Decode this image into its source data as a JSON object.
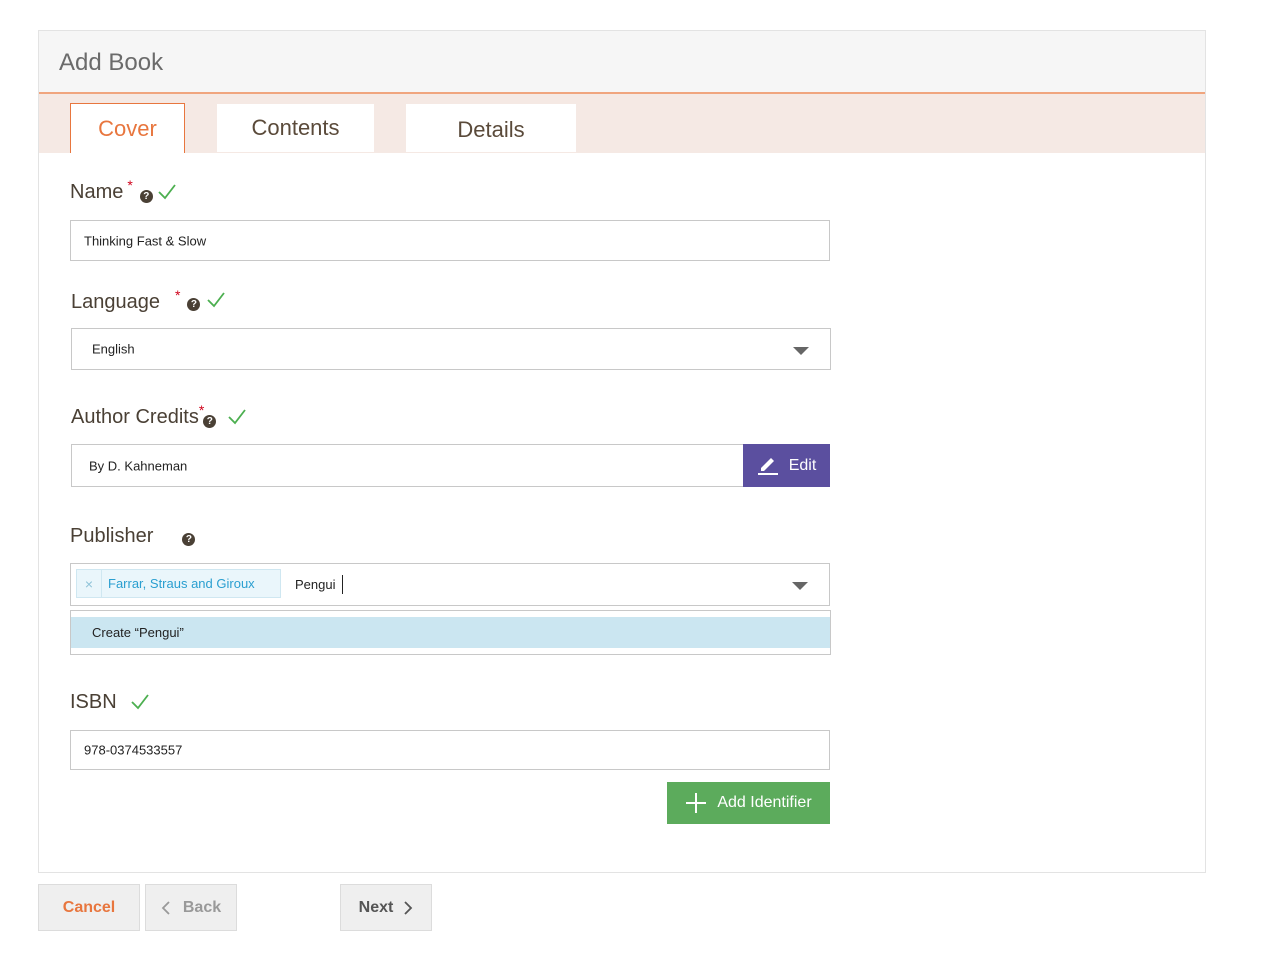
{
  "panel": {
    "title": "Add Book"
  },
  "tabs": [
    {
      "label": "Cover",
      "active": true
    },
    {
      "label": "Contents",
      "active": false
    },
    {
      "label": "Details",
      "active": false
    }
  ],
  "form": {
    "name": {
      "label": "Name",
      "required_mark": "*",
      "value": "Thinking Fast & Slow"
    },
    "language": {
      "label": "Language",
      "required_mark": "*",
      "value": "English"
    },
    "author_credits": {
      "label": "Author Credits",
      "required_mark": "*",
      "value": "By D. Kahneman",
      "edit_label": "Edit"
    },
    "publisher": {
      "label": "Publisher",
      "selected_tag": "Farrar, Straus and Giroux",
      "typed_value": "Pengui",
      "dropdown_option": "Create “Pengui”"
    },
    "isbn": {
      "label": "ISBN",
      "value": "978-0374533557",
      "add_identifier_label": "Add Identifier"
    }
  },
  "help_glyph": "?",
  "tag_remove_glyph": "×",
  "footer": {
    "cancel_label": "Cancel",
    "back_label": "Back",
    "next_label": "Next"
  },
  "colors": {
    "accent_orange": "#e8763e",
    "edit_purple": "#5b4f9f",
    "add_green": "#5cab5c",
    "tag_blue": "#2a9fd0",
    "valid_check": "#4caf50",
    "required": "#d0021b"
  },
  "icons": [
    "help-icon",
    "valid-check-icon",
    "dropdown-arrow-icon",
    "pencil-icon",
    "plus-icon",
    "close-icon",
    "chevron-left-icon",
    "chevron-right-icon"
  ]
}
